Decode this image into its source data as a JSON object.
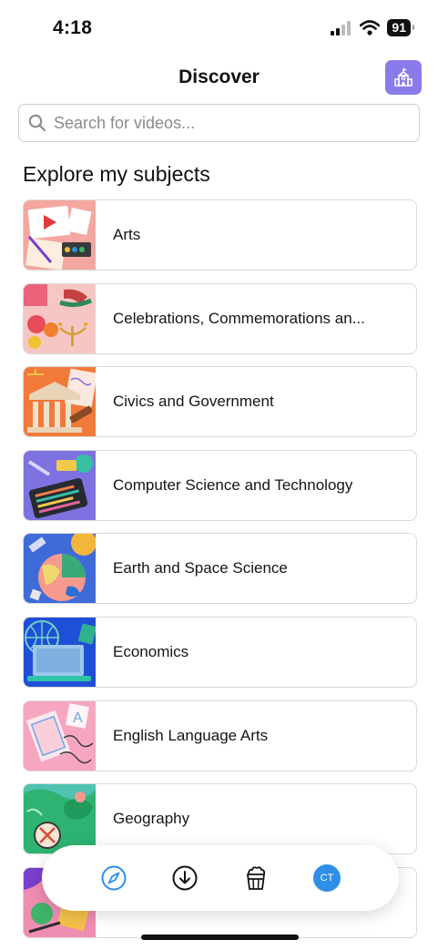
{
  "status_bar": {
    "time": "4:18",
    "battery": "91"
  },
  "nav": {
    "title": "Discover"
  },
  "search": {
    "placeholder": "Search for videos..."
  },
  "section": {
    "heading": "Explore my subjects"
  },
  "subjects": [
    {
      "label": "Arts"
    },
    {
      "label": "Celebrations, Commemorations an..."
    },
    {
      "label": "Civics and Government"
    },
    {
      "label": "Computer Science and Technology"
    },
    {
      "label": "Earth and Space Science"
    },
    {
      "label": "Economics"
    },
    {
      "label": "English Language Arts"
    },
    {
      "label": "Geography"
    },
    {
      "label": ""
    }
  ],
  "tab_bar": {
    "avatar_initials": "CT"
  },
  "colors": {
    "accent": "#8a7bea",
    "tab_active": "#2f8fe6"
  }
}
